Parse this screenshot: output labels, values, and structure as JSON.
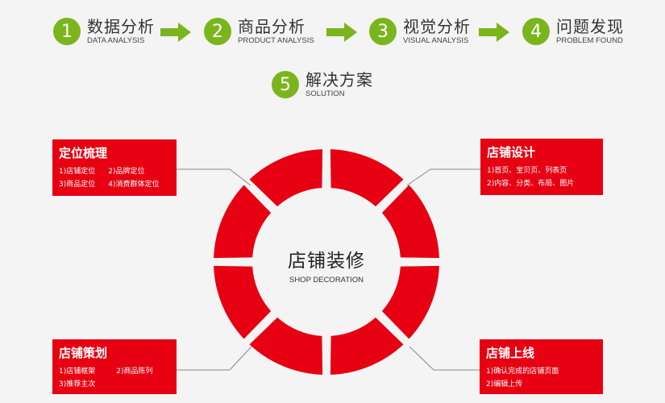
{
  "steps": [
    {
      "num": "1",
      "zh": "数据分析",
      "en": "DATA ANALYSIS"
    },
    {
      "num": "2",
      "zh": "商品分析",
      "en": "PRODUCT ANALYSIS"
    },
    {
      "num": "3",
      "zh": "视觉分析",
      "en": "VISUAL ANALYSIS"
    },
    {
      "num": "4",
      "zh": "问题发现",
      "en": "PROBLEM FOUND"
    },
    {
      "num": "5",
      "zh": "解决方案",
      "en": "SOLUTION"
    }
  ],
  "center": {
    "zh": "店铺装修",
    "en": "SHOP DECORATION"
  },
  "cards": {
    "positioning": {
      "title": "定位梳理",
      "l1a": "1)店铺定位",
      "l1b": "2)品牌定位",
      "l2a": "3)商品定位",
      "l2b": "4)消费群体定位"
    },
    "design": {
      "title": "店铺设计",
      "l1": "1)首页、宝贝页、列表页",
      "l2": "2)内容、分类、布局、图片"
    },
    "planning": {
      "title": "店铺策划",
      "l1a": "1)店铺框架",
      "l1b": "2)商品陈列",
      "l2": "3)推荐主次"
    },
    "launch": {
      "title": "店铺上线",
      "l1": "1)确认完成的店铺页面",
      "l2": "2)编辑上传"
    }
  },
  "colors": {
    "accent_green": "#7ab51d",
    "accent_red": "#e60012"
  }
}
